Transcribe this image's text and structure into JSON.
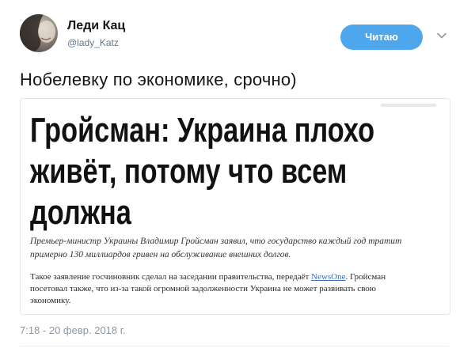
{
  "author": {
    "display_name": "Леди Кац",
    "handle": "@lady_Katz"
  },
  "actions": {
    "follow_label": "Читаю",
    "more_icon": "chevron-down-icon"
  },
  "tweet": {
    "text": "Нобелевку по экономике, срочно)",
    "timestamp": "7:18 - 20 февр. 2018 г."
  },
  "card": {
    "headline_lines": [
      "Гройсман: Украина плохо",
      "живёт, потому что всем",
      "должна"
    ],
    "lede_lines": [
      "Премьер-министр Украины Владимир Гройсман заявил, что государство каждый год тратит",
      "примерно 130 миллиардов гривен на обслуживание внешних долгов."
    ],
    "body_lines": [
      "Такое заявление госчиновник сделал на заседании правительства, передаёт",
      "посетовал также, что из-за такой огромной задолженности Украина не может развивать свою",
      "экономику."
    ],
    "body_link": "NewsOne",
    "body_after_link": ". Гройсман"
  },
  "colors": {
    "follow_button": "#4ea6ec",
    "secondary_text": "#657786",
    "link": "#3b6fb6"
  }
}
